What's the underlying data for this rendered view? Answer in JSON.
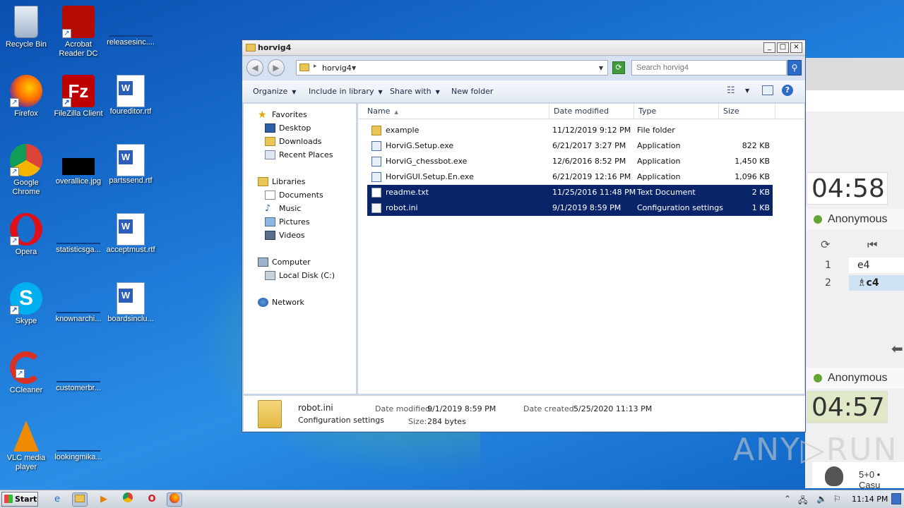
{
  "desktop": {
    "icons": [
      {
        "label": "Recycle Bin"
      },
      {
        "label": "Acrobat Reader DC"
      },
      {
        "label": "releasesinc...."
      },
      {
        "label": "Firefox"
      },
      {
        "label": "FileZilla Client"
      },
      {
        "label": "foureditor.rtf"
      },
      {
        "label": "Google Chrome"
      },
      {
        "label": "overallice.jpg"
      },
      {
        "label": "partssend.rtf"
      },
      {
        "label": "Opera"
      },
      {
        "label": "statisticsga..."
      },
      {
        "label": "acceptmust.rtf"
      },
      {
        "label": "Skype"
      },
      {
        "label": "knownarchi..."
      },
      {
        "label": "boardsinclu..."
      },
      {
        "label": "CCleaner"
      },
      {
        "label": "customerbr..."
      },
      {
        "label": "VLC media player"
      },
      {
        "label": "lookingmika..."
      }
    ]
  },
  "window": {
    "title": "horvig4",
    "controls": {
      "minimize": "_",
      "maximize": "□",
      "close": "×"
    },
    "address": {
      "path": "horvig4",
      "sep": "▸"
    },
    "search": {
      "placeholder": "Search horvig4"
    },
    "toolbar": {
      "organize": "Organize",
      "include_in_library": "Include in library",
      "share_with": "Share with",
      "new_folder": "New folder"
    },
    "nav": {
      "favorites": "Favorites",
      "desktop": "Desktop",
      "downloads": "Downloads",
      "recent_places": "Recent Places",
      "libraries": "Libraries",
      "documents": "Documents",
      "music": "Music",
      "pictures": "Pictures",
      "videos": "Videos",
      "computer": "Computer",
      "local_disk": "Local Disk (C:)",
      "network": "Network"
    },
    "columns": {
      "name": "Name",
      "date_modified": "Date modified",
      "type": "Type",
      "size": "Size"
    },
    "files": [
      {
        "name": "example",
        "date": "11/12/2019 9:12 PM",
        "type": "File folder",
        "size": "",
        "icon": "folder",
        "selected": false
      },
      {
        "name": "HorviG.Setup.exe",
        "date": "6/21/2017 3:27 PM",
        "type": "Application",
        "size": "822 KB",
        "icon": "exe",
        "selected": false
      },
      {
        "name": "HorviG_chessbot.exe",
        "date": "12/6/2016 8:52 PM",
        "type": "Application",
        "size": "1,450 KB",
        "icon": "exe",
        "selected": false
      },
      {
        "name": "HorviGUI.Setup.En.exe",
        "date": "6/21/2019 12:16 PM",
        "type": "Application",
        "size": "1,096 KB",
        "icon": "exe",
        "selected": false
      },
      {
        "name": "readme.txt",
        "date": "11/25/2016 11:48 PM",
        "type": "Text Document",
        "size": "2 KB",
        "icon": "txt",
        "selected": true
      },
      {
        "name": "robot.ini",
        "date": "9/1/2019 8:59 PM",
        "type": "Configuration settings",
        "size": "1 KB",
        "icon": "ini",
        "selected": true
      }
    ],
    "details": {
      "name": "robot.ini",
      "type": "Configuration settings",
      "date_modified_label": "Date modified:",
      "date_modified": "9/1/2019 8:59 PM",
      "date_created_label": "Date created:",
      "date_created": "5/25/2020 11:13 PM",
      "size_label": "Size:",
      "size": "284 bytes"
    }
  },
  "chess": {
    "clock_top": "04:58",
    "player_top": "Anonymous",
    "moves": [
      {
        "num": "1",
        "move": "e4"
      },
      {
        "num": "2",
        "move": "♗c4"
      }
    ],
    "player_bottom": "Anonymous",
    "clock_bottom": "04:57",
    "game_info": "5+0 • Casu"
  },
  "watermark": "ANY▷RUN",
  "taskbar": {
    "start": "Start",
    "time": "11:14 PM"
  }
}
